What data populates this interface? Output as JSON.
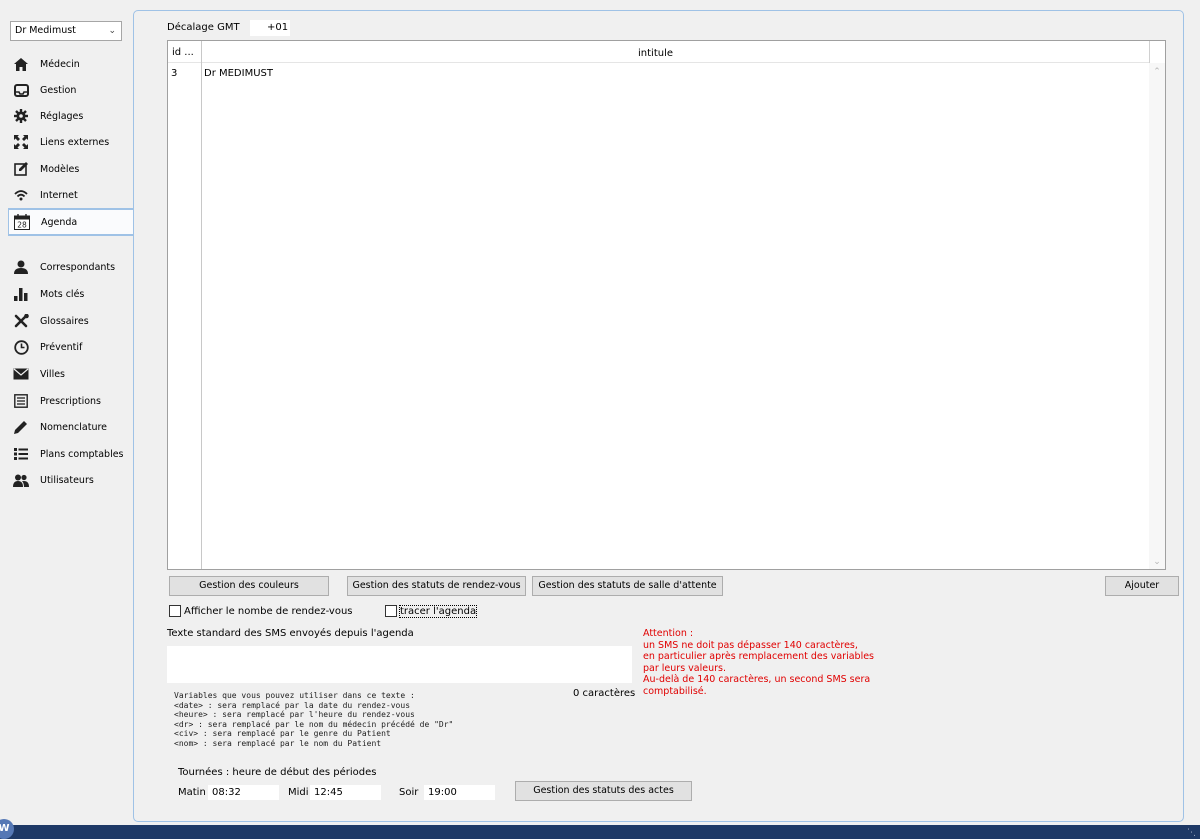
{
  "doctor_select": {
    "value": "Dr Medimust"
  },
  "sidebar": {
    "items": [
      {
        "label": "Médecin",
        "icon": "house-icon"
      },
      {
        "label": "Gestion",
        "icon": "inbox-icon"
      },
      {
        "label": "Réglages",
        "icon": "gear-icon"
      },
      {
        "label": "Liens externes",
        "icon": "expand-icon"
      },
      {
        "label": "Modèles",
        "icon": "edit-icon"
      },
      {
        "label": "Internet",
        "icon": "wifi-icon"
      },
      {
        "label": "Agenda",
        "icon": "calendar-icon",
        "calendar_day": "28"
      },
      {
        "label": "Correspondants",
        "icon": "person-icon"
      },
      {
        "label": "Mots clés",
        "icon": "bar-chart-icon"
      },
      {
        "label": "Glossaires",
        "icon": "tools-icon"
      },
      {
        "label": "Préventif",
        "icon": "clock-icon"
      },
      {
        "label": "Villes",
        "icon": "envelope-icon"
      },
      {
        "label": "Prescriptions",
        "icon": "list-icon"
      },
      {
        "label": "Nomenclature",
        "icon": "pencil-icon"
      },
      {
        "label": "Plans comptables",
        "icon": "list-bullets-icon"
      },
      {
        "label": "Utilisateurs",
        "icon": "users-icon"
      }
    ]
  },
  "gmt": {
    "label": "Décalage GMT",
    "value": "+01"
  },
  "grid": {
    "headers": {
      "id": "id ...",
      "intitule": "intitule"
    },
    "rows": [
      {
        "id": "3",
        "intitule": "Dr MEDIMUST"
      }
    ]
  },
  "buttons": {
    "colors": "Gestion des couleurs",
    "appt_status": "Gestion des statuts de rendez-vous",
    "waiting_status": "Gestion des statuts de salle d'attente",
    "add": "Ajouter",
    "acts_status": "Gestion des statuts des actes"
  },
  "checkboxes": {
    "show_count": {
      "label": "Afficher le nombe de rendez-vous",
      "checked": false
    },
    "trace": {
      "label": "tracer l'agenda",
      "checked": false
    }
  },
  "sms": {
    "title": "Texte standard des SMS envoyés depuis l'agenda",
    "value": "",
    "char_count": "0 caractères",
    "variables_help": "Variables que vous pouvez utiliser dans ce texte :\n<date> : sera remplacé par la date du rendez-vous\n<heure> : sera remplacé par l'heure du rendez-vous\n<dr> : sera remplacé par le nom du médecin précédé de \"Dr\"\n<civ> : sera remplacé par le genre du Patient\n<nom> : sera remplacé par le nom du Patient",
    "warning": "Attention :\nun SMS ne doit pas dépasser 140 caractères,\nen particulier après remplacement des variables\npar leurs valeurs.\nAu-delà de 140 caractères, un second SMS sera\ncomptabilisé."
  },
  "tours": {
    "title": "Tournées : heure de début des périodes",
    "matin_label": "Matin",
    "matin": "08:32",
    "midi_label": "Midi",
    "midi": "12:45",
    "soir_label": "Soir",
    "soir": "19:00"
  },
  "taskbar": {
    "badge": "W"
  },
  "colors": {
    "accent_border": "#9fc2e6",
    "warning": "#e00000",
    "taskbar": "#1e3966"
  }
}
